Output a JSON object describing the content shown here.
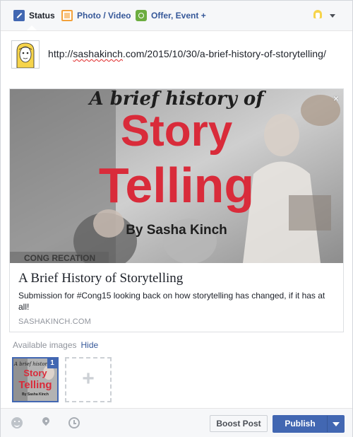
{
  "composer": {
    "tabs": [
      {
        "label": "Status",
        "icon": "pencil-icon"
      },
      {
        "label": "Photo / Video",
        "icon": "photo-icon"
      },
      {
        "label": "Offer, Event +",
        "icon": "offer-icon"
      }
    ],
    "audience_icon": "avatar-icon"
  },
  "post": {
    "text_prefix": "http://",
    "text_spell": "sashakinch",
    "text_suffix": ".com/2015/10/30/a-brief-history-of-storytelling/"
  },
  "preview": {
    "image_text": {
      "line1": "A brief history of",
      "line2": "Story",
      "line3": "Telling",
      "line4": "By Sasha Kinch",
      "corner": "CONG RECATION"
    },
    "title": "A Brief History of Storytelling",
    "description": "Submission for #Cong15 looking back on how storytelling has changed, if it has at all!",
    "domain": "SASHAKINCH.COM",
    "close_label": "×"
  },
  "images": {
    "label": "Available images",
    "hide_label": "Hide",
    "selected_index": "1",
    "add_label": "+"
  },
  "footer": {
    "boost_label": "Boost Post",
    "publish_label": "Publish"
  },
  "colors": {
    "brand": "#4267b2",
    "link": "#365899",
    "title_red": "#d92b3a"
  }
}
